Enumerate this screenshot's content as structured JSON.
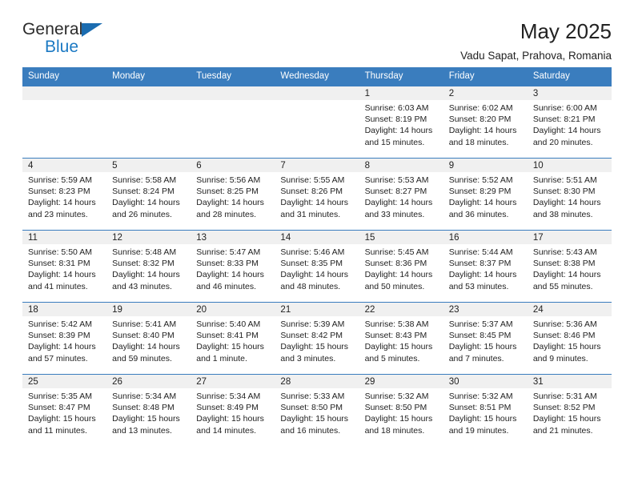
{
  "brand": {
    "line1": "General",
    "line2": "Blue",
    "accent_color": "#1b79c3",
    "triangle_color": "#1b6cb0"
  },
  "header": {
    "title": "May 2025",
    "subtitle": "Vadu Sapat, Prahova, Romania"
  },
  "calendar": {
    "header_bg": "#3a7dbe",
    "daynum_bg": "#f0f0f0",
    "weekday_labels": [
      "Sunday",
      "Monday",
      "Tuesday",
      "Wednesday",
      "Thursday",
      "Friday",
      "Saturday"
    ],
    "labels": {
      "sunrise_prefix": "Sunrise:",
      "sunset_prefix": "Sunset:",
      "daylight_prefix": "Daylight:"
    },
    "weeks": [
      [
        {
          "day": "",
          "empty": true
        },
        {
          "day": "",
          "empty": true
        },
        {
          "day": "",
          "empty": true
        },
        {
          "day": "",
          "empty": true
        },
        {
          "day": "1",
          "sunrise": "Sunrise: 6:03 AM",
          "sunset": "Sunset: 8:19 PM",
          "daylight_line1": "Daylight: 14 hours",
          "daylight_line2": "and 15 minutes."
        },
        {
          "day": "2",
          "sunrise": "Sunrise: 6:02 AM",
          "sunset": "Sunset: 8:20 PM",
          "daylight_line1": "Daylight: 14 hours",
          "daylight_line2": "and 18 minutes."
        },
        {
          "day": "3",
          "sunrise": "Sunrise: 6:00 AM",
          "sunset": "Sunset: 8:21 PM",
          "daylight_line1": "Daylight: 14 hours",
          "daylight_line2": "and 20 minutes."
        }
      ],
      [
        {
          "day": "4",
          "sunrise": "Sunrise: 5:59 AM",
          "sunset": "Sunset: 8:23 PM",
          "daylight_line1": "Daylight: 14 hours",
          "daylight_line2": "and 23 minutes."
        },
        {
          "day": "5",
          "sunrise": "Sunrise: 5:58 AM",
          "sunset": "Sunset: 8:24 PM",
          "daylight_line1": "Daylight: 14 hours",
          "daylight_line2": "and 26 minutes."
        },
        {
          "day": "6",
          "sunrise": "Sunrise: 5:56 AM",
          "sunset": "Sunset: 8:25 PM",
          "daylight_line1": "Daylight: 14 hours",
          "daylight_line2": "and 28 minutes."
        },
        {
          "day": "7",
          "sunrise": "Sunrise: 5:55 AM",
          "sunset": "Sunset: 8:26 PM",
          "daylight_line1": "Daylight: 14 hours",
          "daylight_line2": "and 31 minutes."
        },
        {
          "day": "8",
          "sunrise": "Sunrise: 5:53 AM",
          "sunset": "Sunset: 8:27 PM",
          "daylight_line1": "Daylight: 14 hours",
          "daylight_line2": "and 33 minutes."
        },
        {
          "day": "9",
          "sunrise": "Sunrise: 5:52 AM",
          "sunset": "Sunset: 8:29 PM",
          "daylight_line1": "Daylight: 14 hours",
          "daylight_line2": "and 36 minutes."
        },
        {
          "day": "10",
          "sunrise": "Sunrise: 5:51 AM",
          "sunset": "Sunset: 8:30 PM",
          "daylight_line1": "Daylight: 14 hours",
          "daylight_line2": "and 38 minutes."
        }
      ],
      [
        {
          "day": "11",
          "sunrise": "Sunrise: 5:50 AM",
          "sunset": "Sunset: 8:31 PM",
          "daylight_line1": "Daylight: 14 hours",
          "daylight_line2": "and 41 minutes."
        },
        {
          "day": "12",
          "sunrise": "Sunrise: 5:48 AM",
          "sunset": "Sunset: 8:32 PM",
          "daylight_line1": "Daylight: 14 hours",
          "daylight_line2": "and 43 minutes."
        },
        {
          "day": "13",
          "sunrise": "Sunrise: 5:47 AM",
          "sunset": "Sunset: 8:33 PM",
          "daylight_line1": "Daylight: 14 hours",
          "daylight_line2": "and 46 minutes."
        },
        {
          "day": "14",
          "sunrise": "Sunrise: 5:46 AM",
          "sunset": "Sunset: 8:35 PM",
          "daylight_line1": "Daylight: 14 hours",
          "daylight_line2": "and 48 minutes."
        },
        {
          "day": "15",
          "sunrise": "Sunrise: 5:45 AM",
          "sunset": "Sunset: 8:36 PM",
          "daylight_line1": "Daylight: 14 hours",
          "daylight_line2": "and 50 minutes."
        },
        {
          "day": "16",
          "sunrise": "Sunrise: 5:44 AM",
          "sunset": "Sunset: 8:37 PM",
          "daylight_line1": "Daylight: 14 hours",
          "daylight_line2": "and 53 minutes."
        },
        {
          "day": "17",
          "sunrise": "Sunrise: 5:43 AM",
          "sunset": "Sunset: 8:38 PM",
          "daylight_line1": "Daylight: 14 hours",
          "daylight_line2": "and 55 minutes."
        }
      ],
      [
        {
          "day": "18",
          "sunrise": "Sunrise: 5:42 AM",
          "sunset": "Sunset: 8:39 PM",
          "daylight_line1": "Daylight: 14 hours",
          "daylight_line2": "and 57 minutes."
        },
        {
          "day": "19",
          "sunrise": "Sunrise: 5:41 AM",
          "sunset": "Sunset: 8:40 PM",
          "daylight_line1": "Daylight: 14 hours",
          "daylight_line2": "and 59 minutes."
        },
        {
          "day": "20",
          "sunrise": "Sunrise: 5:40 AM",
          "sunset": "Sunset: 8:41 PM",
          "daylight_line1": "Daylight: 15 hours",
          "daylight_line2": "and 1 minute."
        },
        {
          "day": "21",
          "sunrise": "Sunrise: 5:39 AM",
          "sunset": "Sunset: 8:42 PM",
          "daylight_line1": "Daylight: 15 hours",
          "daylight_line2": "and 3 minutes."
        },
        {
          "day": "22",
          "sunrise": "Sunrise: 5:38 AM",
          "sunset": "Sunset: 8:43 PM",
          "daylight_line1": "Daylight: 15 hours",
          "daylight_line2": "and 5 minutes."
        },
        {
          "day": "23",
          "sunrise": "Sunrise: 5:37 AM",
          "sunset": "Sunset: 8:45 PM",
          "daylight_line1": "Daylight: 15 hours",
          "daylight_line2": "and 7 minutes."
        },
        {
          "day": "24",
          "sunrise": "Sunrise: 5:36 AM",
          "sunset": "Sunset: 8:46 PM",
          "daylight_line1": "Daylight: 15 hours",
          "daylight_line2": "and 9 minutes."
        }
      ],
      [
        {
          "day": "25",
          "sunrise": "Sunrise: 5:35 AM",
          "sunset": "Sunset: 8:47 PM",
          "daylight_line1": "Daylight: 15 hours",
          "daylight_line2": "and 11 minutes."
        },
        {
          "day": "26",
          "sunrise": "Sunrise: 5:34 AM",
          "sunset": "Sunset: 8:48 PM",
          "daylight_line1": "Daylight: 15 hours",
          "daylight_line2": "and 13 minutes."
        },
        {
          "day": "27",
          "sunrise": "Sunrise: 5:34 AM",
          "sunset": "Sunset: 8:49 PM",
          "daylight_line1": "Daylight: 15 hours",
          "daylight_line2": "and 14 minutes."
        },
        {
          "day": "28",
          "sunrise": "Sunrise: 5:33 AM",
          "sunset": "Sunset: 8:50 PM",
          "daylight_line1": "Daylight: 15 hours",
          "daylight_line2": "and 16 minutes."
        },
        {
          "day": "29",
          "sunrise": "Sunrise: 5:32 AM",
          "sunset": "Sunset: 8:50 PM",
          "daylight_line1": "Daylight: 15 hours",
          "daylight_line2": "and 18 minutes."
        },
        {
          "day": "30",
          "sunrise": "Sunrise: 5:32 AM",
          "sunset": "Sunset: 8:51 PM",
          "daylight_line1": "Daylight: 15 hours",
          "daylight_line2": "and 19 minutes."
        },
        {
          "day": "31",
          "sunrise": "Sunrise: 5:31 AM",
          "sunset": "Sunset: 8:52 PM",
          "daylight_line1": "Daylight: 15 hours",
          "daylight_line2": "and 21 minutes."
        }
      ]
    ]
  }
}
